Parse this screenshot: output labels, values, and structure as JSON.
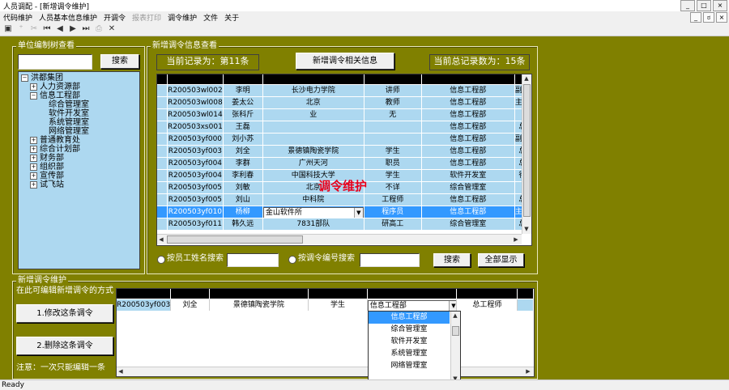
{
  "window": {
    "title": "人员调配 - [新增调令维护]",
    "controls": [
      "_",
      "□",
      "×"
    ],
    "mdi_controls": [
      "_",
      "ಠ",
      "×"
    ]
  },
  "menu": [
    {
      "label": "代码维护",
      "enabled": true
    },
    {
      "label": "人员基本信息维护",
      "enabled": true
    },
    {
      "label": "开调令",
      "enabled": true
    },
    {
      "label": "报表打印",
      "enabled": false
    },
    {
      "label": "调令维护",
      "enabled": true
    },
    {
      "label": "文件",
      "enabled": true
    },
    {
      "label": "关于",
      "enabled": true
    }
  ],
  "toolbar": {
    "close_glyph": "✕"
  },
  "tree_panel": {
    "title": "单位编制树查看",
    "search_button": "搜索",
    "search_value": "",
    "nodes": [
      {
        "label": "洪都集团",
        "exp": "−"
      },
      {
        "label": "人力资源部",
        "exp": "+"
      },
      {
        "label": "信息工程部",
        "exp": "−"
      },
      {
        "label": "综合管理室",
        "exp": ""
      },
      {
        "label": "软件开发室",
        "exp": ""
      },
      {
        "label": "系统管理室",
        "exp": ""
      },
      {
        "label": "网络管理室",
        "exp": ""
      },
      {
        "label": "普通教育处",
        "exp": "+"
      },
      {
        "label": "综合计划部",
        "exp": "+"
      },
      {
        "label": "财务部",
        "exp": "+"
      },
      {
        "label": "组织部",
        "exp": "+"
      },
      {
        "label": "宣传部",
        "exp": "+"
      },
      {
        "label": "试飞站",
        "exp": "+"
      }
    ]
  },
  "info_panel": {
    "title": "新增调令信息查看",
    "current_record": "当前记录为：第11条",
    "info_button": "新增调令相关信息",
    "total_records": "当前总记录数为：15条",
    "rows": [
      [
        "R200503wl002",
        "李明",
        "长沙电力学院",
        "讲师",
        "信息工程部",
        "副总"
      ],
      [
        "R200503wl008",
        "姜太公",
        "北京",
        "教师",
        "信息工程部",
        "主任"
      ],
      [
        "R200503wl014",
        "张科斤",
        "业",
        "无",
        "信息工程部",
        ""
      ],
      [
        "R200503xs001",
        "王磊",
        "",
        "",
        "信息工程部",
        "总"
      ],
      [
        "R200503yf000",
        "刘小苏",
        "",
        "",
        "信息工程部",
        "副总"
      ],
      [
        "R200503yf003",
        "刘全",
        "景德镇陶瓷学院",
        "学生",
        "信息工程部",
        "总"
      ],
      [
        "R200503yf004",
        "李群",
        "广州天河",
        "职员",
        "信息工程部",
        "总"
      ],
      [
        "R200503yf004",
        "李利春",
        "中国科技大学",
        "学生",
        "软件开发室",
        "待"
      ],
      [
        "R200503yf005",
        "刘敏",
        "北京",
        "不详",
        "综合管理室",
        ""
      ],
      [
        "R200503yf005",
        "刘山",
        "中科院",
        "工程师",
        "信息工程部",
        "总"
      ],
      [
        "R200503yf010",
        "杨柳",
        "金山软件所",
        "程序员",
        "信息工程部",
        "主任"
      ],
      [
        "R200503yf011",
        "韩久远",
        "7831部队",
        "研高工",
        "综合管理室",
        "总"
      ]
    ],
    "selected_row": 10,
    "watermark": "调令维护",
    "radio_name": "按员工姓名搜索",
    "radio_code": "按调令编号搜索",
    "name_value": "",
    "code_value": "",
    "search_button": "搜索",
    "show_all_button": "全部显示"
  },
  "maint_panel": {
    "title": "新增调令维护",
    "hint": "在此可编辑新增调令的方式",
    "modify_button": "1.修改这条调令",
    "delete_button": "2.删除这条调令",
    "note": "注意：一次只能编辑一条",
    "edit_row": [
      "R200503yf003",
      "刘全",
      "景德镇陶瓷学院",
      "学生",
      "信息工程部",
      "总工程师"
    ],
    "dropdown_options": [
      "信息工程部",
      "综合管理室",
      "软件开发室",
      "系统管理室",
      "网络管理室"
    ]
  },
  "status": "Ready"
}
